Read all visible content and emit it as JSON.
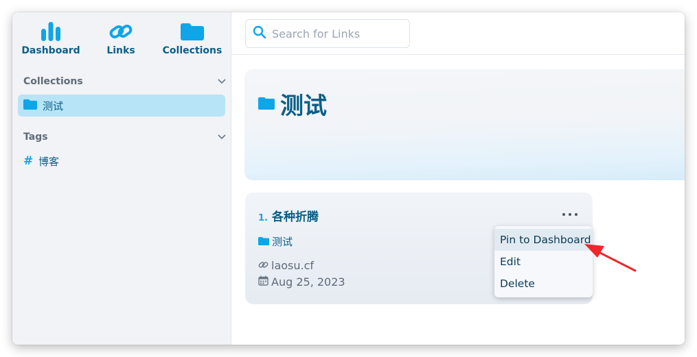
{
  "nav": {
    "dashboard": "Dashboard",
    "links": "Links",
    "collections": "Collections"
  },
  "sidebar": {
    "collections_title": "Collections",
    "collection_item": "测试",
    "tags_title": "Tags",
    "tag_item": "博客"
  },
  "search": {
    "placeholder": "Search for Links"
  },
  "hero": {
    "title": "测试"
  },
  "card": {
    "index": "1.",
    "title": "各种折腾",
    "collection": "测试",
    "url": "laosu.cf",
    "date": "Aug 25, 2023"
  },
  "menu": {
    "items": [
      "Pin to Dashboard",
      "Edit",
      "Delete"
    ]
  },
  "colors": {
    "accent": "#0ea5e9",
    "primary_text": "#0b5f87",
    "selected_bg": "#b7e4f7",
    "annotation_arrow": "#f0262c"
  }
}
